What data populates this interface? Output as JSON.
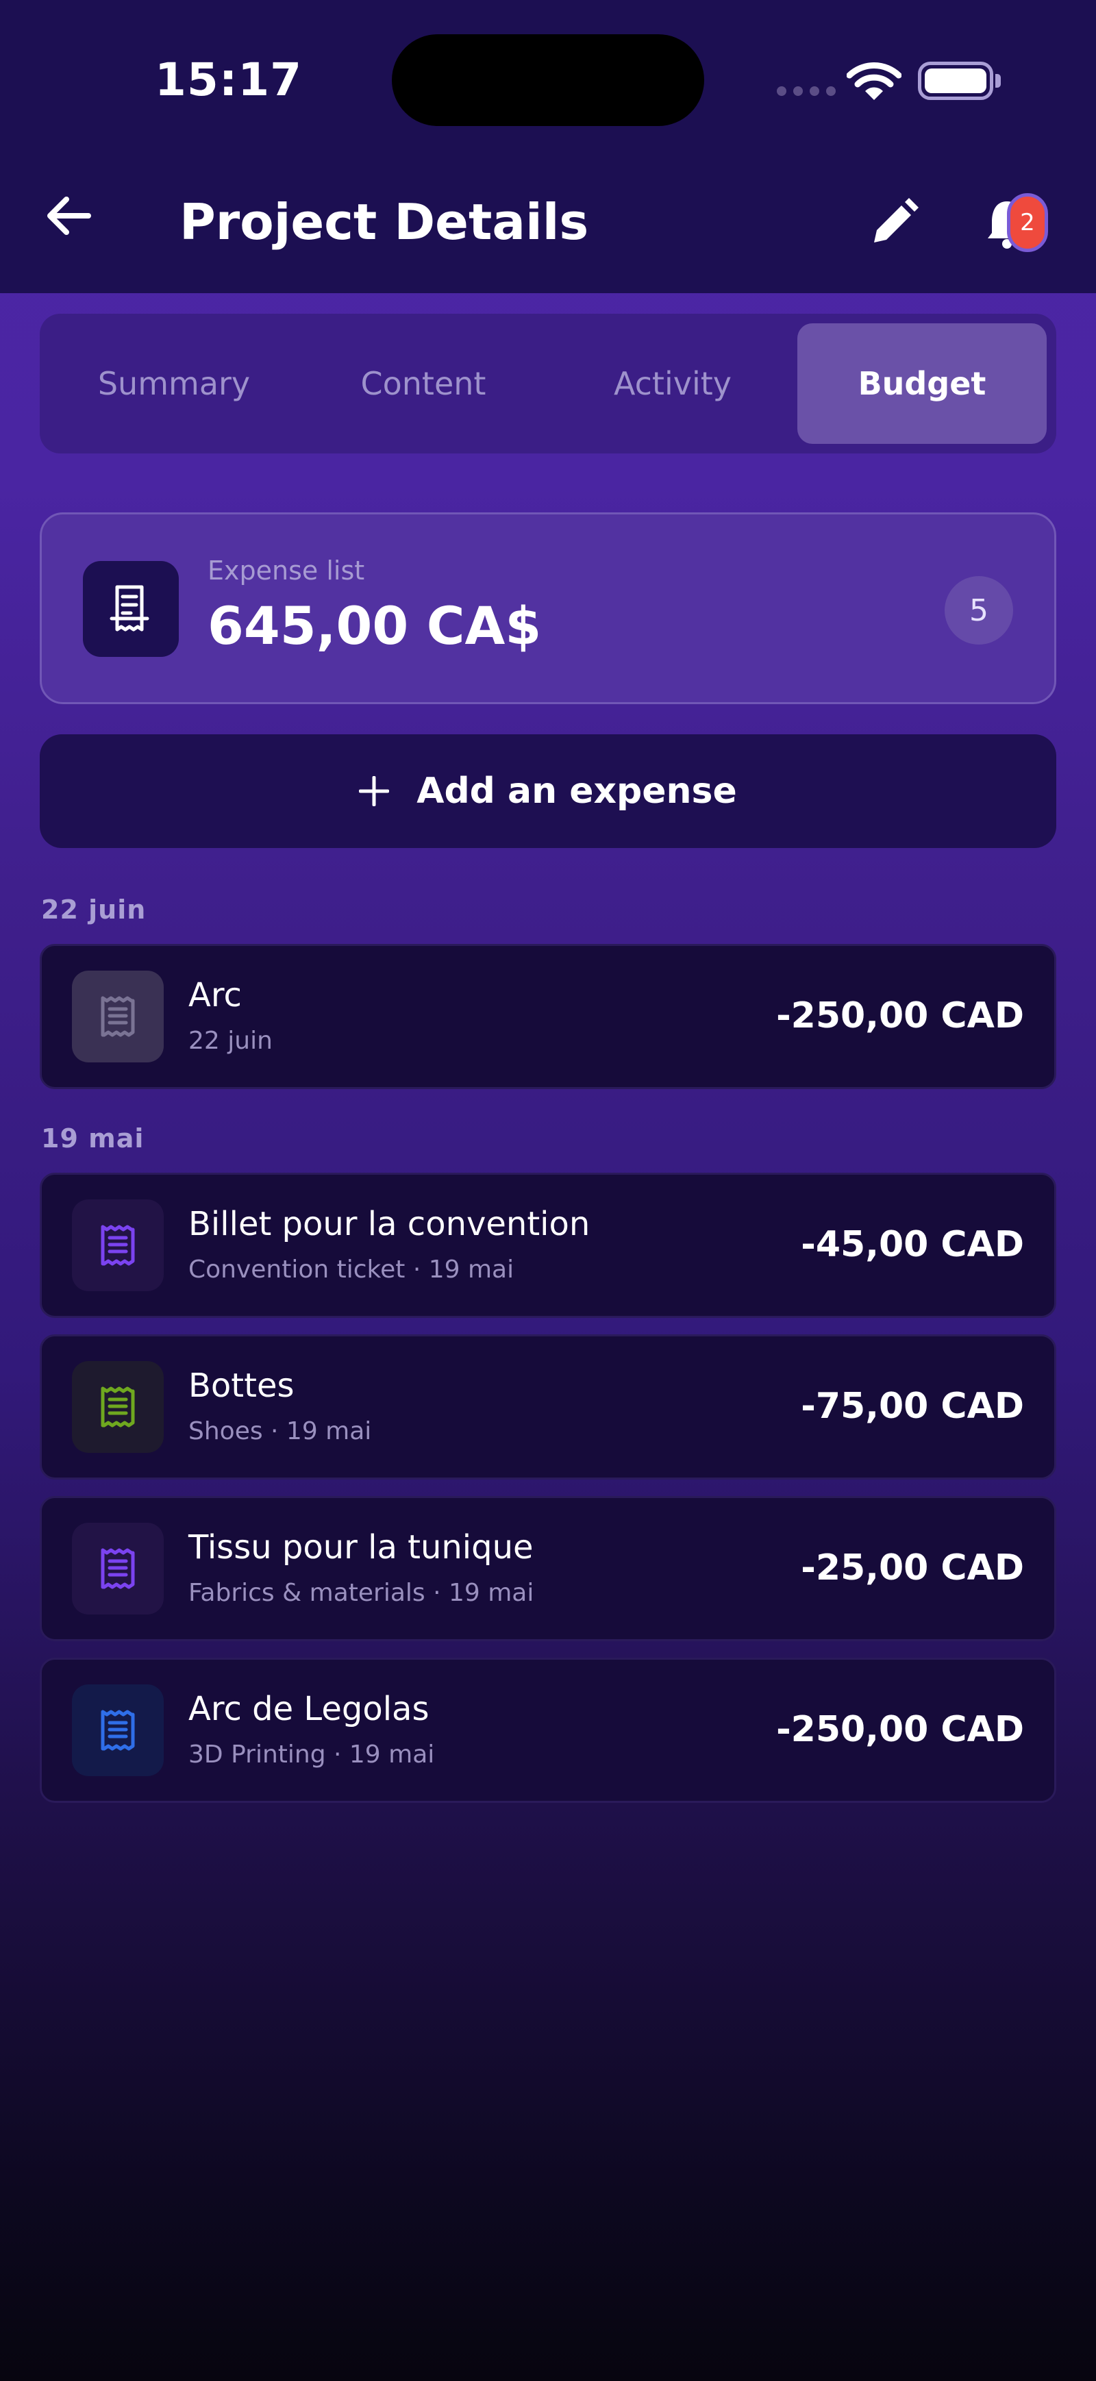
{
  "status": {
    "time": "15:17"
  },
  "header": {
    "title": "Project Details",
    "notification_count": "2"
  },
  "tabs": [
    {
      "label": "Summary",
      "active": false
    },
    {
      "label": "Content",
      "active": false
    },
    {
      "label": "Activity",
      "active": false
    },
    {
      "label": "Budget",
      "active": true
    }
  ],
  "summary": {
    "label": "Expense list",
    "total": "645,00 CA$",
    "count": "5"
  },
  "add_button": {
    "label": "Add an expense"
  },
  "groups": [
    {
      "date": "22 juin",
      "items": [
        {
          "title": "Arc",
          "subtitle": "22 juin",
          "amount": "-250,00 CAD",
          "icon_color": "#7a7394",
          "icon_bg": "#3a3154"
        }
      ]
    },
    {
      "date": "19 mai",
      "items": [
        {
          "title": "Billet pour la convention",
          "subtitle": "Convention ticket · 19 mai",
          "amount": "-45,00 CAD",
          "icon_color": "#7b43f0",
          "icon_bg": "#221346"
        },
        {
          "title": "Bottes",
          "subtitle": "Shoes · 19 mai",
          "amount": "-75,00 CAD",
          "icon_color": "#6fa81f",
          "icon_bg": "#1e1a2e"
        },
        {
          "title": "Tissu pour la tunique",
          "subtitle": "Fabrics & materials · 19 mai",
          "amount": "-25,00 CAD",
          "icon_color": "#7b43f0",
          "icon_bg": "#221346"
        },
        {
          "title": "Arc de Legolas",
          "subtitle": "3D Printing · 19 mai",
          "amount": "-250,00 CAD",
          "icon_color": "#2f6ee8",
          "icon_bg": "#131a4a"
        }
      ]
    }
  ],
  "colors": {
    "badge": "#ef4a3d",
    "header_bg": "#1c0f52",
    "row_bg": "#160b3a"
  }
}
